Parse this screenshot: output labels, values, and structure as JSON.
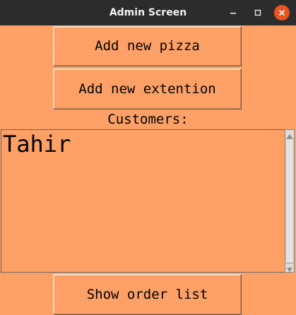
{
  "window": {
    "title": "Admin Screen"
  },
  "buttons": {
    "add_pizza": "Add new pizza",
    "add_extension": "Add new extention",
    "show_orders": "Show order list"
  },
  "customers": {
    "label": "Customers:",
    "items": [
      "Tahir"
    ]
  },
  "icons": {
    "minimize": "minimize-icon",
    "maximize": "maximize-icon",
    "close": "close-icon"
  },
  "colors": {
    "background": "#FFA066",
    "titlebar": "#2c2c2c",
    "close_button": "#E95420"
  }
}
